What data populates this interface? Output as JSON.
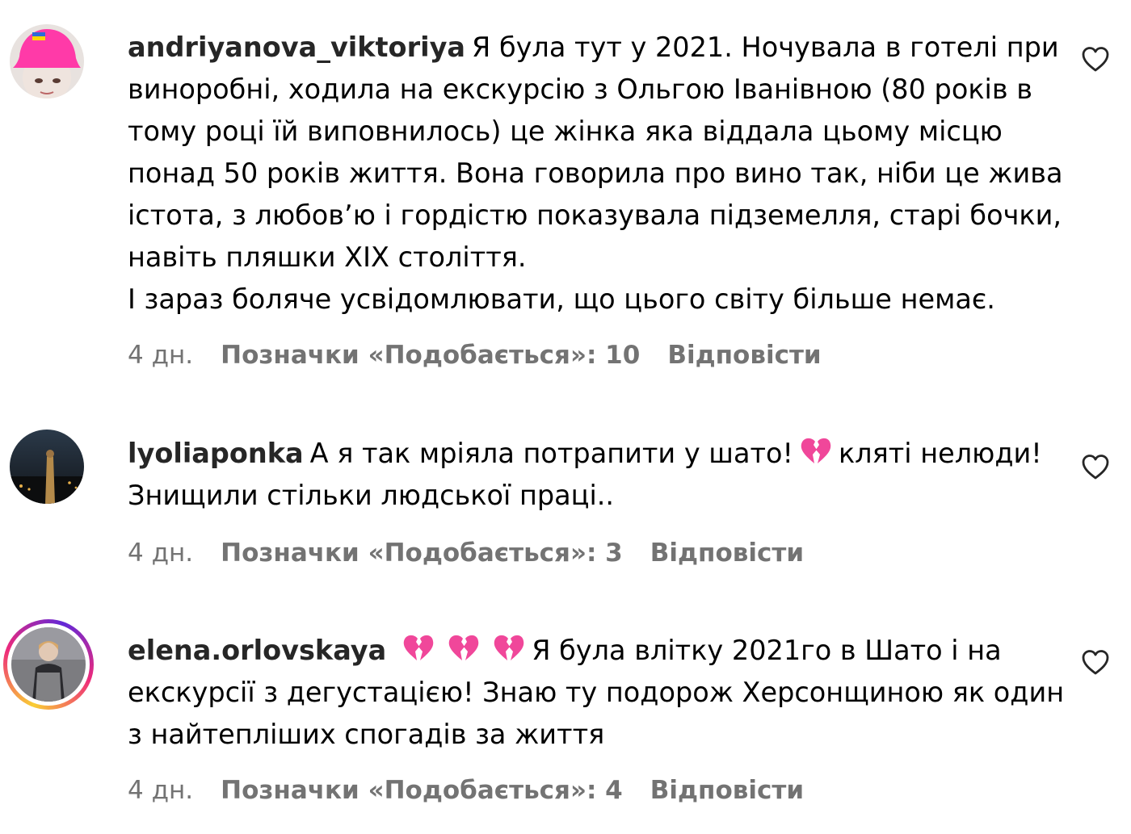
{
  "comments": [
    {
      "username": "andriyanova_viktoriya",
      "text": "Я була тут у 2021. Ночувала в готелі при виноробні, ходила на екскурсію з Ольгою Іванівною (80 років в тому році їй виповнилось) це жінка яка віддала цьому місцю понад 50 років життя. Вона говорила про вино так, ніби це жива істота, з любов’ю і гордістю показувала підземелля, старі бочки, навіть пляшки XIX століття.\nІ зараз боляче усвідомлювати, що цього світу більше немає.",
      "time": "4 дн.",
      "likes": "Позначки «Подобається»: 10",
      "reply": "Відповісти",
      "avatar_icon": "avatar-pink-hat",
      "like_icon": "heart-outline-icon"
    },
    {
      "username": "lyoliaponka",
      "text_before_emoji": "А я так мріяла потрапити у шато!",
      "emoji_icon": "broken-heart-icon",
      "text_after_emoji": "кляті нелюди! Знищили стільки людської праці..",
      "time": "4 дн.",
      "likes": "Позначки «Подобається»: 3",
      "reply": "Відповісти",
      "avatar_icon": "avatar-night-landscape",
      "like_icon": "heart-outline-icon"
    },
    {
      "username": "elena.orlovskaya",
      "emoji_icons": [
        "broken-heart-icon",
        "broken-heart-icon",
        "broken-heart-icon"
      ],
      "text": "Я була влітку 2021го в Шато і на екскурсії з дегустацією! Знаю ту подорож Херсонщиною як один з найтепліших спогадів за життя",
      "time": "4 дн.",
      "likes": "Позначки «Подобається»: 4",
      "reply": "Відповісти",
      "avatar_icon": "avatar-woman-story-ring",
      "like_icon": "heart-outline-icon"
    }
  ],
  "colors": {
    "username": "#262626",
    "meta": "#737373",
    "broken_heart": "#f0479a",
    "story_ring": "#ee2a7b"
  }
}
